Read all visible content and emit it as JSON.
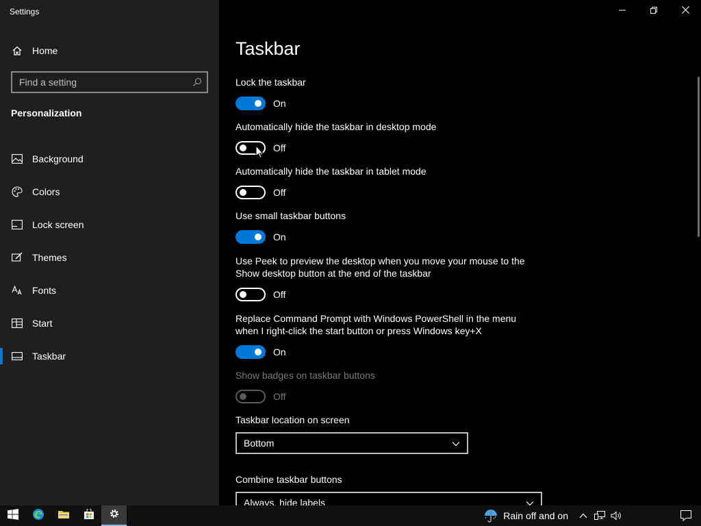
{
  "app_title": "Settings",
  "sidebar": {
    "home_label": "Home",
    "search_placeholder": "Find a setting",
    "section_title": "Personalization",
    "items": [
      {
        "label": "Background",
        "icon": "picture-icon"
      },
      {
        "label": "Colors",
        "icon": "palette-icon"
      },
      {
        "label": "Lock screen",
        "icon": "lock-screen-icon"
      },
      {
        "label": "Themes",
        "icon": "brush-icon"
      },
      {
        "label": "Fonts",
        "icon": "font-icon"
      },
      {
        "label": "Start",
        "icon": "start-icon"
      },
      {
        "label": "Taskbar",
        "icon": "taskbar-icon",
        "active": true
      }
    ]
  },
  "main": {
    "title": "Taskbar",
    "settings": [
      {
        "label": "Lock the taskbar",
        "state": "On"
      },
      {
        "label": "Automatically hide the taskbar in desktop mode",
        "state": "Off"
      },
      {
        "label": "Automatically hide the taskbar in tablet mode",
        "state": "Off"
      },
      {
        "label": "Use small taskbar buttons",
        "state": "On"
      },
      {
        "label_line1": "Use Peek to preview the desktop when you move your mouse to the",
        "label_line2": "Show desktop button at the end of the taskbar",
        "state": "Off"
      },
      {
        "label_line1": "Replace Command Prompt with Windows PowerShell in the menu",
        "label_line2": "when I right-click the start button or press Windows key+X",
        "state": "On"
      },
      {
        "label": "Show badges on taskbar buttons",
        "state": "Off",
        "disabled": true
      }
    ],
    "location_label": "Taskbar location on screen",
    "location_value": "Bottom",
    "combine_label": "Combine taskbar buttons",
    "combine_value": "Always, hide labels"
  },
  "taskbar": {
    "weather_text": "Rain off and on"
  },
  "colors": {
    "accent": "#0078d7",
    "sidebar_bg": "#1f1f1f",
    "main_bg": "#000000"
  }
}
